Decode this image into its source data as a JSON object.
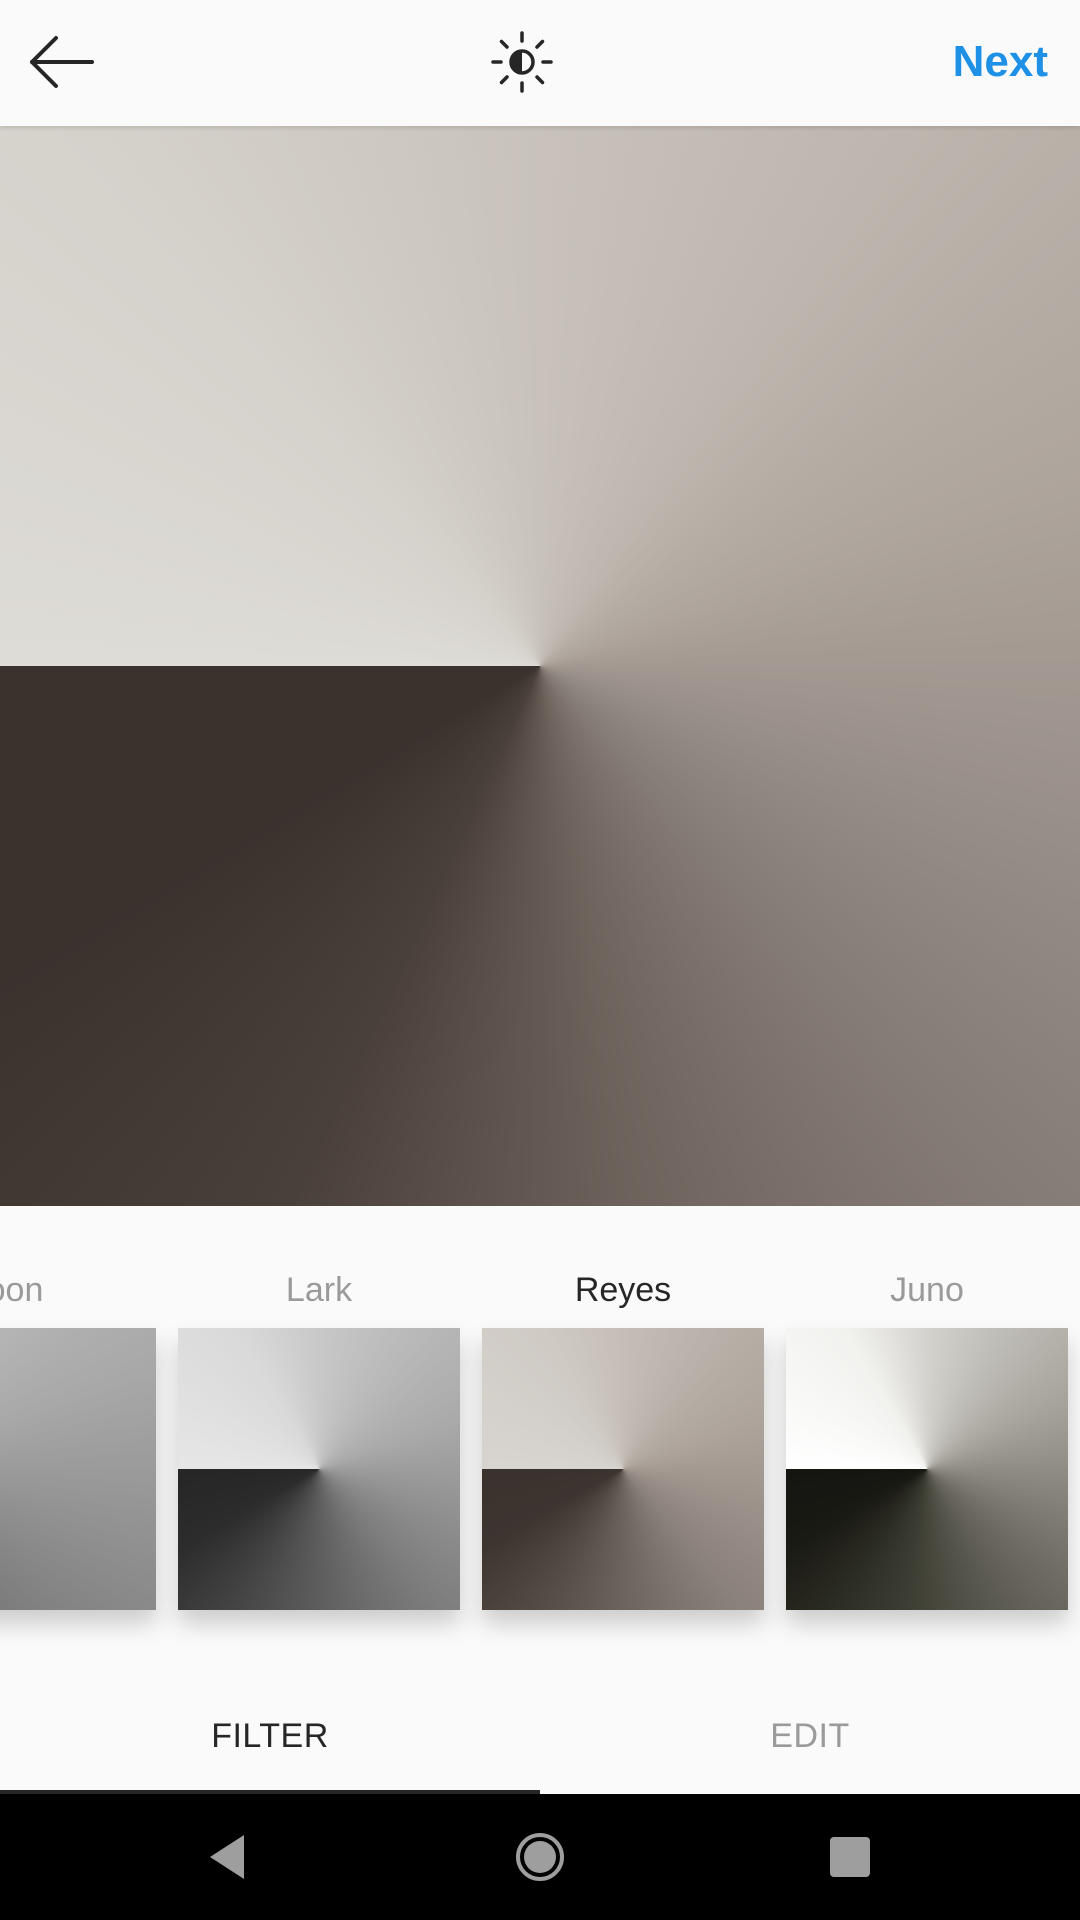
{
  "header": {
    "back_icon": "back-arrow-icon",
    "lux_icon": "lux-brightness-icon",
    "next_label": "Next",
    "accent_color": "#1e90e6"
  },
  "filters": {
    "items": [
      {
        "label": "oon",
        "selected": false
      },
      {
        "label": "Lark",
        "selected": false
      },
      {
        "label": "Reyes",
        "selected": true
      },
      {
        "label": "Juno",
        "selected": false
      }
    ]
  },
  "tabs": {
    "filter_label": "FILTER",
    "edit_label": "EDIT",
    "active": "FILTER"
  },
  "system_nav": {
    "back_icon": "nav-back-icon",
    "home_icon": "nav-home-icon",
    "recent_icon": "nav-recent-apps-icon"
  }
}
